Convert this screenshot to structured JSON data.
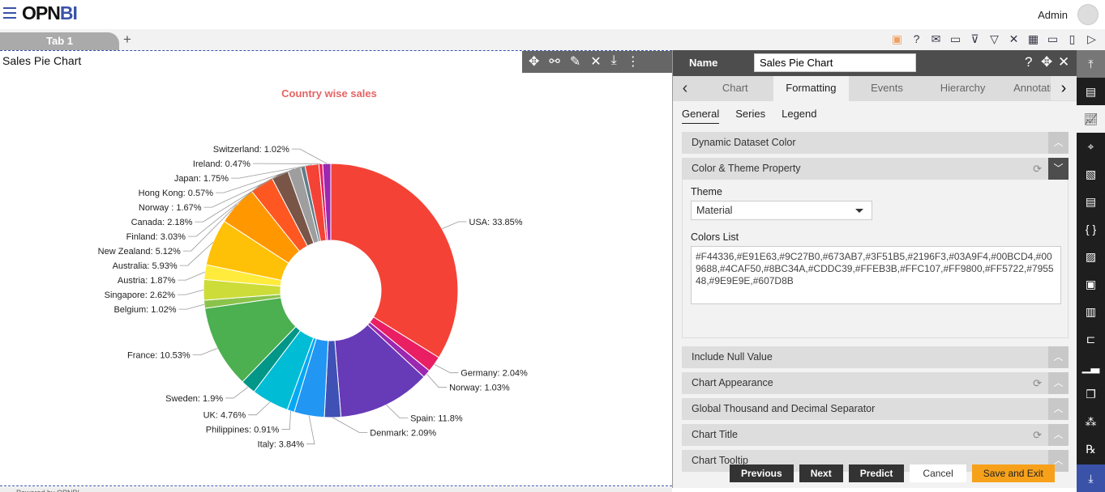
{
  "header": {
    "logo_prefix": "OPN",
    "logo_suffix": "BI",
    "user": "Admin"
  },
  "tabs": [
    {
      "label": "Tab 1"
    }
  ],
  "add_tab": "+",
  "toolbar_icons": [
    "save-icon",
    "help-icon",
    "mail-icon",
    "comment-icon",
    "clear-filter-icon",
    "filter-icon",
    "tools-icon",
    "table-icon",
    "embed-icon",
    "devices-icon",
    "play-icon"
  ],
  "widget": {
    "title": "Sales Pie Chart",
    "tools": [
      "move-icon",
      "link-icon",
      "edit-icon",
      "settings-icon",
      "download-icon",
      "more-icon"
    ]
  },
  "footer": "Powered by OPNBI",
  "chart_data": {
    "type": "pie",
    "title": "Country wise sales",
    "donut": true,
    "title_color": "#E46464",
    "categories": [
      "USA",
      "Germany",
      "Norway",
      "Spain",
      "Denmark",
      "Italy",
      "Philippines",
      "UK",
      "Sweden",
      "France",
      "Belgium",
      "Singapore",
      "Austria",
      "Australia",
      "New Zealand",
      "Finland",
      "Canada",
      "Norway ",
      "Hong Kong",
      "Japan",
      "Ireland",
      "Switzerland"
    ],
    "values": [
      33.85,
      2.04,
      1.03,
      11.8,
      2.09,
      3.84,
      0.91,
      4.76,
      1.9,
      10.53,
      1.02,
      2.62,
      1.87,
      5.93,
      5.12,
      3.03,
      2.18,
      1.67,
      0.57,
      1.75,
      0.47,
      1.02
    ],
    "labels": [
      "USA: 33.85%",
      "Germany: 2.04%",
      "Norway: 1.03%",
      "Spain: 11.8%",
      "Denmark: 2.09%",
      "Italy: 3.84%",
      "Philippines: 0.91%",
      "UK: 4.76%",
      "Sweden: 1.9%",
      "France: 10.53%",
      "Belgium: 1.02%",
      "Singapore: 2.62%",
      "Austria: 1.87%",
      "Australia: 5.93%",
      "New Zealand: 5.12%",
      "Finland: 3.03%",
      "Canada: 2.18%",
      "Norway : 1.67%",
      "Hong Kong: 0.57%",
      "Japan: 1.75%",
      "Ireland: 0.47%",
      "Switzerland: 1.02%"
    ],
    "colors": [
      "#F44336",
      "#E91E63",
      "#9C27B0",
      "#673AB7",
      "#3F51B5",
      "#2196F3",
      "#03A9F4",
      "#00BCD4",
      "#009688",
      "#4CAF50",
      "#8BC34A",
      "#CDDC39",
      "#FFEB3B",
      "#FFC107",
      "#FF9800",
      "#FF5722",
      "#795548",
      "#9E9E9E",
      "#607D8B",
      "#F44336",
      "#E91E63",
      "#9C27B0"
    ]
  },
  "panel": {
    "name_label": "Name",
    "name_value": "Sales Pie Chart",
    "tabs": [
      "Chart",
      "Formatting",
      "Events",
      "Hierarchy",
      "Annotation"
    ],
    "active_tab": "Formatting",
    "subtabs": [
      "General",
      "Series",
      "Legend"
    ],
    "sections": [
      "Dynamic Dataset Color",
      "Color & Theme Property",
      "Include Null Value",
      "Chart Appearance",
      "Global Thousand and Decimal Separator",
      "Chart Title",
      "Chart Tooltip"
    ],
    "theme_label": "Theme",
    "theme_value": "Material",
    "colors_label": "Colors List",
    "colors_value": "#F44336,#E91E63,#9C27B0,#673AB7,#3F51B5,#2196F3,#03A9F4,#00BCD4,#009688,#4CAF50,#8BC34A,#CDDC39,#FFEB3B,#FFC107,#FF9800,#FF5722,#795548,#9E9E9E,#607D8B",
    "buttons": {
      "previous": "Previous",
      "next": "Next",
      "predict": "Predict",
      "cancel": "Cancel",
      "save": "Save and Exit"
    }
  },
  "accent": "#3A52A8"
}
